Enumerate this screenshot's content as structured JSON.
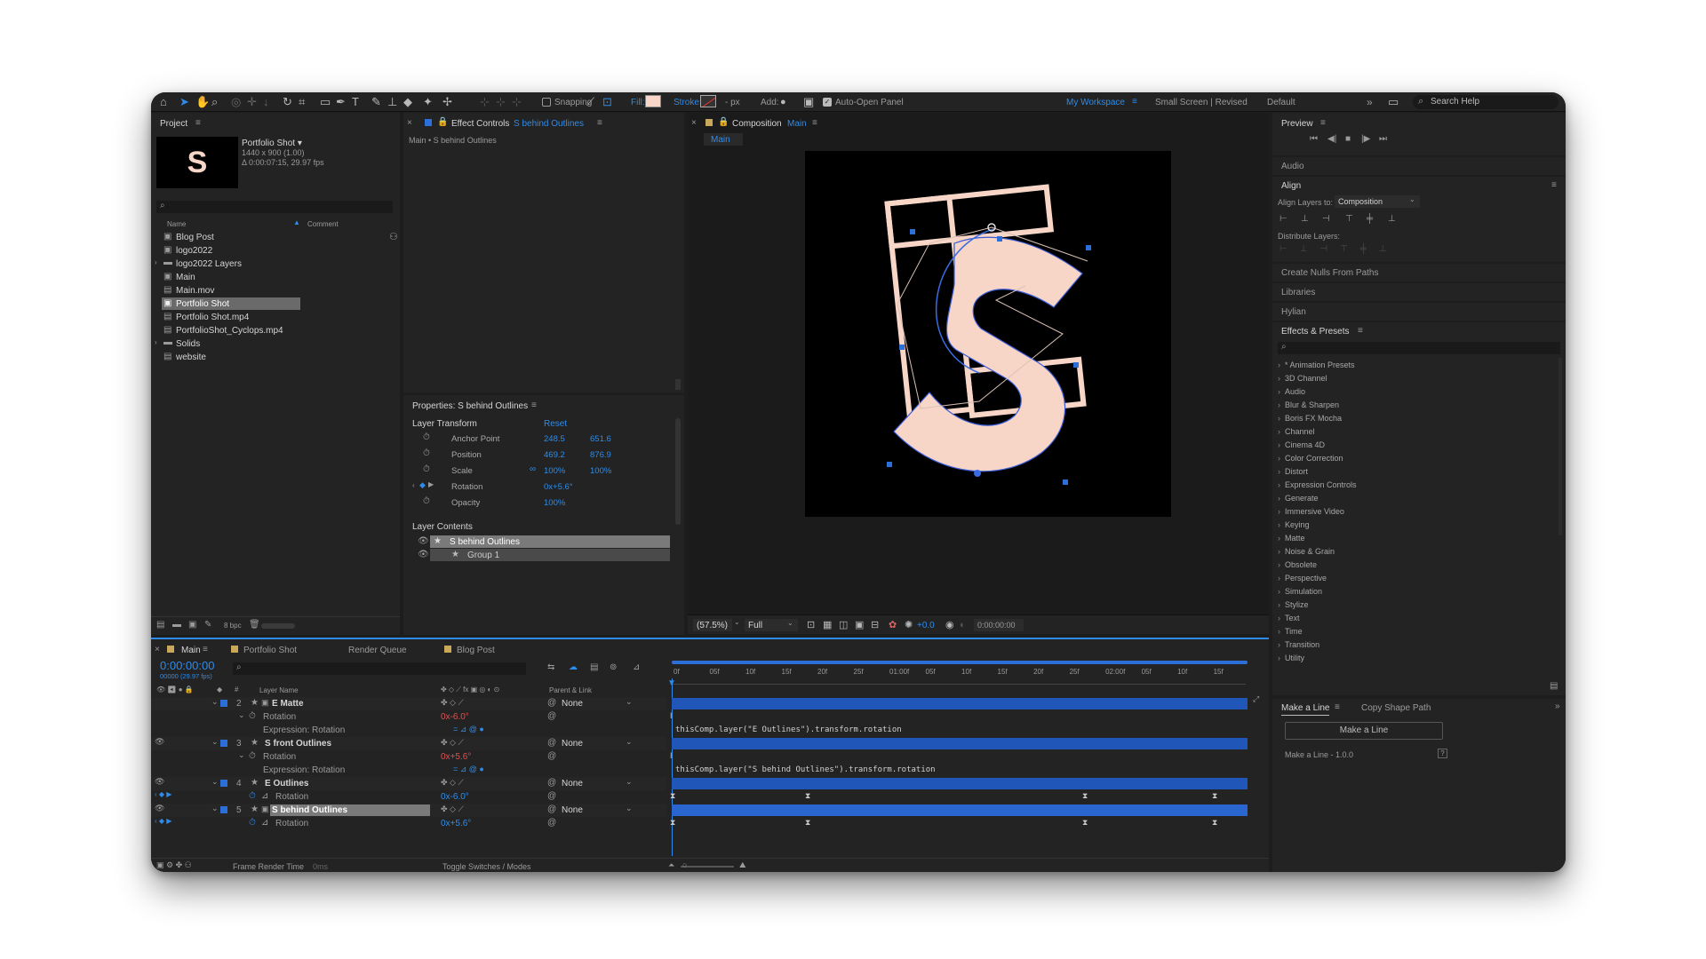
{
  "toolbar": {
    "snapping_label": "Snapping",
    "fill_label": "Fill:",
    "stroke_label": "Stroke:",
    "stroke_px": "- px",
    "add_label": "Add:",
    "auto_open_label": "Auto-Open Panel",
    "workspaces": [
      "My Workspace",
      "Small Screen | Revised",
      "Default"
    ],
    "search_placeholder": "Search Help",
    "fill_color": "#f7d6c8"
  },
  "project": {
    "title": "Project",
    "item_name": "Portfolio Shot ▾",
    "item_dims": "1440 x 900 (1.00)",
    "item_dur": "Δ 0:00:07:15, 29.97 fps",
    "col_name": "Name",
    "col_comment": "Comment",
    "items": [
      {
        "label": "Blog Post",
        "icon": "comp-icon"
      },
      {
        "label": "logo2022",
        "icon": "comp-icon"
      },
      {
        "label": "logo2022 Layers",
        "icon": "folder-icon"
      },
      {
        "label": "Main",
        "icon": "comp-icon"
      },
      {
        "label": "Main.mov",
        "icon": "file-icon"
      },
      {
        "label": "Portfolio Shot",
        "icon": "comp-icon"
      },
      {
        "label": "Portfolio Shot.mp4",
        "icon": "file-icon"
      },
      {
        "label": "PortfolioShot_Cyclops.mp4",
        "icon": "file-icon"
      },
      {
        "label": "Solids",
        "icon": "folder-icon"
      },
      {
        "label": "website",
        "icon": "file-icon"
      }
    ],
    "bpc": "8 bpc"
  },
  "effect_controls": {
    "tab_prefix": "Effect Controls",
    "tab_layer": "S behind Outlines",
    "breadcrumb": "Main • S behind Outlines"
  },
  "properties": {
    "title": "Properties: S behind Outlines",
    "section_transform": "Layer Transform",
    "reset": "Reset",
    "rows": [
      {
        "name": "Anchor Point",
        "v1": "248.5",
        "v2": "651.6"
      },
      {
        "name": "Position",
        "v1": "469.2",
        "v2": "876.9"
      },
      {
        "name": "Scale",
        "v1": "100%",
        "v2": "100%"
      },
      {
        "name": "Rotation",
        "v1": "0x+5.6°",
        "v2": ""
      },
      {
        "name": "Opacity",
        "v1": "100%",
        "v2": ""
      }
    ],
    "section_contents": "Layer Contents",
    "contents": [
      "S behind Outlines",
      "Group 1"
    ]
  },
  "composition": {
    "tab_prefix": "Composition",
    "tab_name": "Main",
    "sub_tab": "Main",
    "zoom": "(57.5%)",
    "resolution": "Full",
    "exposure": "+0.0",
    "timecode": "0:00:00:00"
  },
  "right": {
    "preview": "Preview",
    "audio": "Audio",
    "align": "Align",
    "align_to_label": "Align Layers to:",
    "align_to_value": "Composition",
    "distribute": "Distribute Layers:",
    "create_nulls": "Create Nulls From Paths",
    "libraries": "Libraries",
    "hylian": "Hylian",
    "effects_title": "Effects & Presets",
    "effects": [
      "* Animation Presets",
      "3D Channel",
      "Audio",
      "Blur & Sharpen",
      "Boris FX Mocha",
      "Channel",
      "Cinema 4D",
      "Color Correction",
      "Distort",
      "Expression Controls",
      "Generate",
      "Immersive Video",
      "Keying",
      "Matte",
      "Noise & Grain",
      "Obsolete",
      "Perspective",
      "Simulation",
      "Stylize",
      "Text",
      "Time",
      "Transition",
      "Utility"
    ],
    "make_a_line_tab": "Make a Line",
    "copy_shape_tab": "Copy Shape Path",
    "make_a_line_button": "Make a Line",
    "make_a_line_version": "Make a Line - 1.0.0"
  },
  "timeline": {
    "tabs": [
      "Main",
      "Portfolio Shot",
      "Render Queue",
      "Blog Post"
    ],
    "timecode": "0:00:00:00",
    "fps": "00000 (29.97 fps)",
    "col_layer_name": "Layer Name",
    "col_parent": "Parent & Link",
    "ruler": [
      "0f",
      "05f",
      "10f",
      "15f",
      "20f",
      "25f",
      "01:00f",
      "05f",
      "10f",
      "15f",
      "20f",
      "25f",
      "02:00f",
      "05f",
      "10f",
      "15f"
    ],
    "layers": [
      {
        "num": "2",
        "name": "E Matte",
        "parent": "None"
      },
      {
        "sub": "Rotation",
        "value": "0x-6.0°"
      },
      {
        "sub": "Expression: Rotation",
        "expr": "thisComp.layer(\"E Outlines\").transform.rotation"
      },
      {
        "num": "3",
        "name": "S front Outlines",
        "parent": "None"
      },
      {
        "sub": "Rotation",
        "value": "0x+5.6°"
      },
      {
        "sub": "Expression: Rotation",
        "expr": "thisComp.layer(\"S behind Outlines\").transform.rotation"
      },
      {
        "num": "4",
        "name": "E Outlines",
        "parent": "None"
      },
      {
        "sub": "Rotation",
        "value": "0x-6.0°"
      },
      {
        "num": "5",
        "name": "S behind Outlines",
        "parent": "None"
      },
      {
        "sub": "Rotation",
        "value": "0x+5.6°"
      }
    ],
    "footer_render": "Frame Render Time",
    "footer_ms": "0ms",
    "footer_toggle": "Toggle Switches / Modes"
  }
}
